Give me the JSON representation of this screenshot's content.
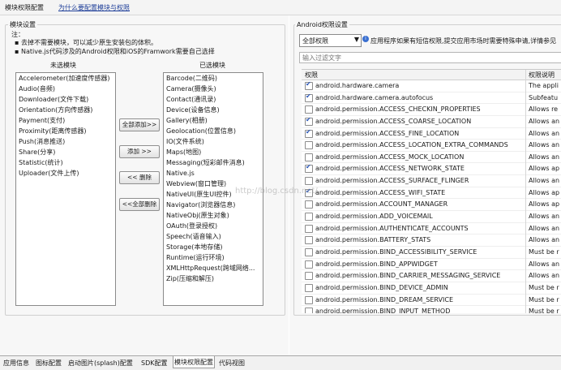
{
  "top_tabs": {
    "active": "模块权限配置",
    "link": "为什么要配置模块与权限"
  },
  "modules": {
    "group_title": "模块设置",
    "note_label": "注：",
    "notes": [
      "去掉不需要模块，可以减少原生安装包的体积。",
      "Native.js代码涉及的Android权限和iOS的Framwork需要自己选择"
    ],
    "available_header": "未选模块",
    "selected_header": "已选模块",
    "available": [
      "Accelerometer(加速度传感器)",
      "Audio(音频)",
      "Downloader(文件下载)",
      "Orientation(方向传感器)",
      "Payment(支付)",
      "Proximity(距离传感器)",
      "Push(消息推送)",
      "Share(分享)",
      "Statistic(统计)",
      "Uploader(文件上传)"
    ],
    "selected": [
      "Barcode(二维码)",
      "Camera(摄像头)",
      "Contact(通讯录)",
      "Device(设备信息)",
      "Gallery(相册)",
      "Geolocation(位置信息)",
      "IO(文件系统)",
      "Maps(地图)",
      "Messaging(短彩邮件消息)",
      "Native.js",
      "Webview(窗口管理)",
      "NativeUI(原生UI控件)",
      "Navigator(浏览器信息)",
      "NativeObj(原生对象)",
      "OAuth(登录授权)",
      "Speech(语音输入)",
      "Storage(本地存储)",
      "Runtime(运行环境)",
      "XMLHttpRequest(跨域网络...",
      "Zip(压缩和解压)"
    ],
    "buttons": {
      "add_all": "全部添加>>",
      "add": "添加 >>",
      "remove": "<< 删除",
      "remove_all": "<<全部删除"
    }
  },
  "android": {
    "group_title": "Android权限设置",
    "filter_selected": "全部权限",
    "hint": "应用程序如果有短信权限,提交应用市场时需要特殊申请,详情参见",
    "search_placeholder": "输入过滤文字",
    "columns": {
      "name": "权限",
      "desc": "权限说明"
    },
    "rows": [
      {
        "name": "android.hardware.camera",
        "checked": true,
        "desc": "The appli"
      },
      {
        "name": "android.hardware.camera.autofocus",
        "checked": true,
        "desc": "Subfeatu"
      },
      {
        "name": "android.permission.ACCESS_CHECKIN_PROPERTIES",
        "checked": false,
        "desc": "Allows re"
      },
      {
        "name": "android.permission.ACCESS_COARSE_LOCATION",
        "checked": true,
        "desc": "Allows an"
      },
      {
        "name": "android.permission.ACCESS_FINE_LOCATION",
        "checked": true,
        "desc": "Allows an"
      },
      {
        "name": "android.permission.ACCESS_LOCATION_EXTRA_COMMANDS",
        "checked": false,
        "desc": "Allows an"
      },
      {
        "name": "android.permission.ACCESS_MOCK_LOCATION",
        "checked": false,
        "desc": "Allows an"
      },
      {
        "name": "android.permission.ACCESS_NETWORK_STATE",
        "checked": true,
        "desc": "Allows ap"
      },
      {
        "name": "android.permission.ACCESS_SURFACE_FLINGER",
        "checked": false,
        "desc": "Allows an"
      },
      {
        "name": "android.permission.ACCESS_WIFI_STATE",
        "checked": true,
        "desc": "Allows ap"
      },
      {
        "name": "android.permission.ACCOUNT_MANAGER",
        "checked": false,
        "desc": "Allows ap"
      },
      {
        "name": "android.permission.ADD_VOICEMAIL",
        "checked": false,
        "desc": "Allows an"
      },
      {
        "name": "android.permission.AUTHENTICATE_ACCOUNTS",
        "checked": false,
        "desc": "Allows an"
      },
      {
        "name": "android.permission.BATTERY_STATS",
        "checked": false,
        "desc": "Allows an"
      },
      {
        "name": "android.permission.BIND_ACCESSIBILITY_SERVICE",
        "checked": false,
        "desc": "Must be r"
      },
      {
        "name": "android.permission.BIND_APPWIDGET",
        "checked": false,
        "desc": "Allows an"
      },
      {
        "name": "android.permission.BIND_CARRIER_MESSAGING_SERVICE",
        "checked": false,
        "desc": "Allows an"
      },
      {
        "name": "android.permission.BIND_DEVICE_ADMIN",
        "checked": false,
        "desc": "Must be r"
      },
      {
        "name": "android.permission.BIND_DREAM_SERVICE",
        "checked": false,
        "desc": "Must be r"
      },
      {
        "name": "android.permission.BIND_INPUT_METHOD",
        "checked": false,
        "desc": "Must be r"
      }
    ]
  },
  "bottom_tabs": [
    "应用信息",
    "图标配置",
    "启动图片(splash)配置",
    "SDK配置",
    "模块权限配置",
    "代码视图"
  ],
  "bottom_selected": "模块权限配置",
  "watermark": "http://blog.csdn.net/"
}
